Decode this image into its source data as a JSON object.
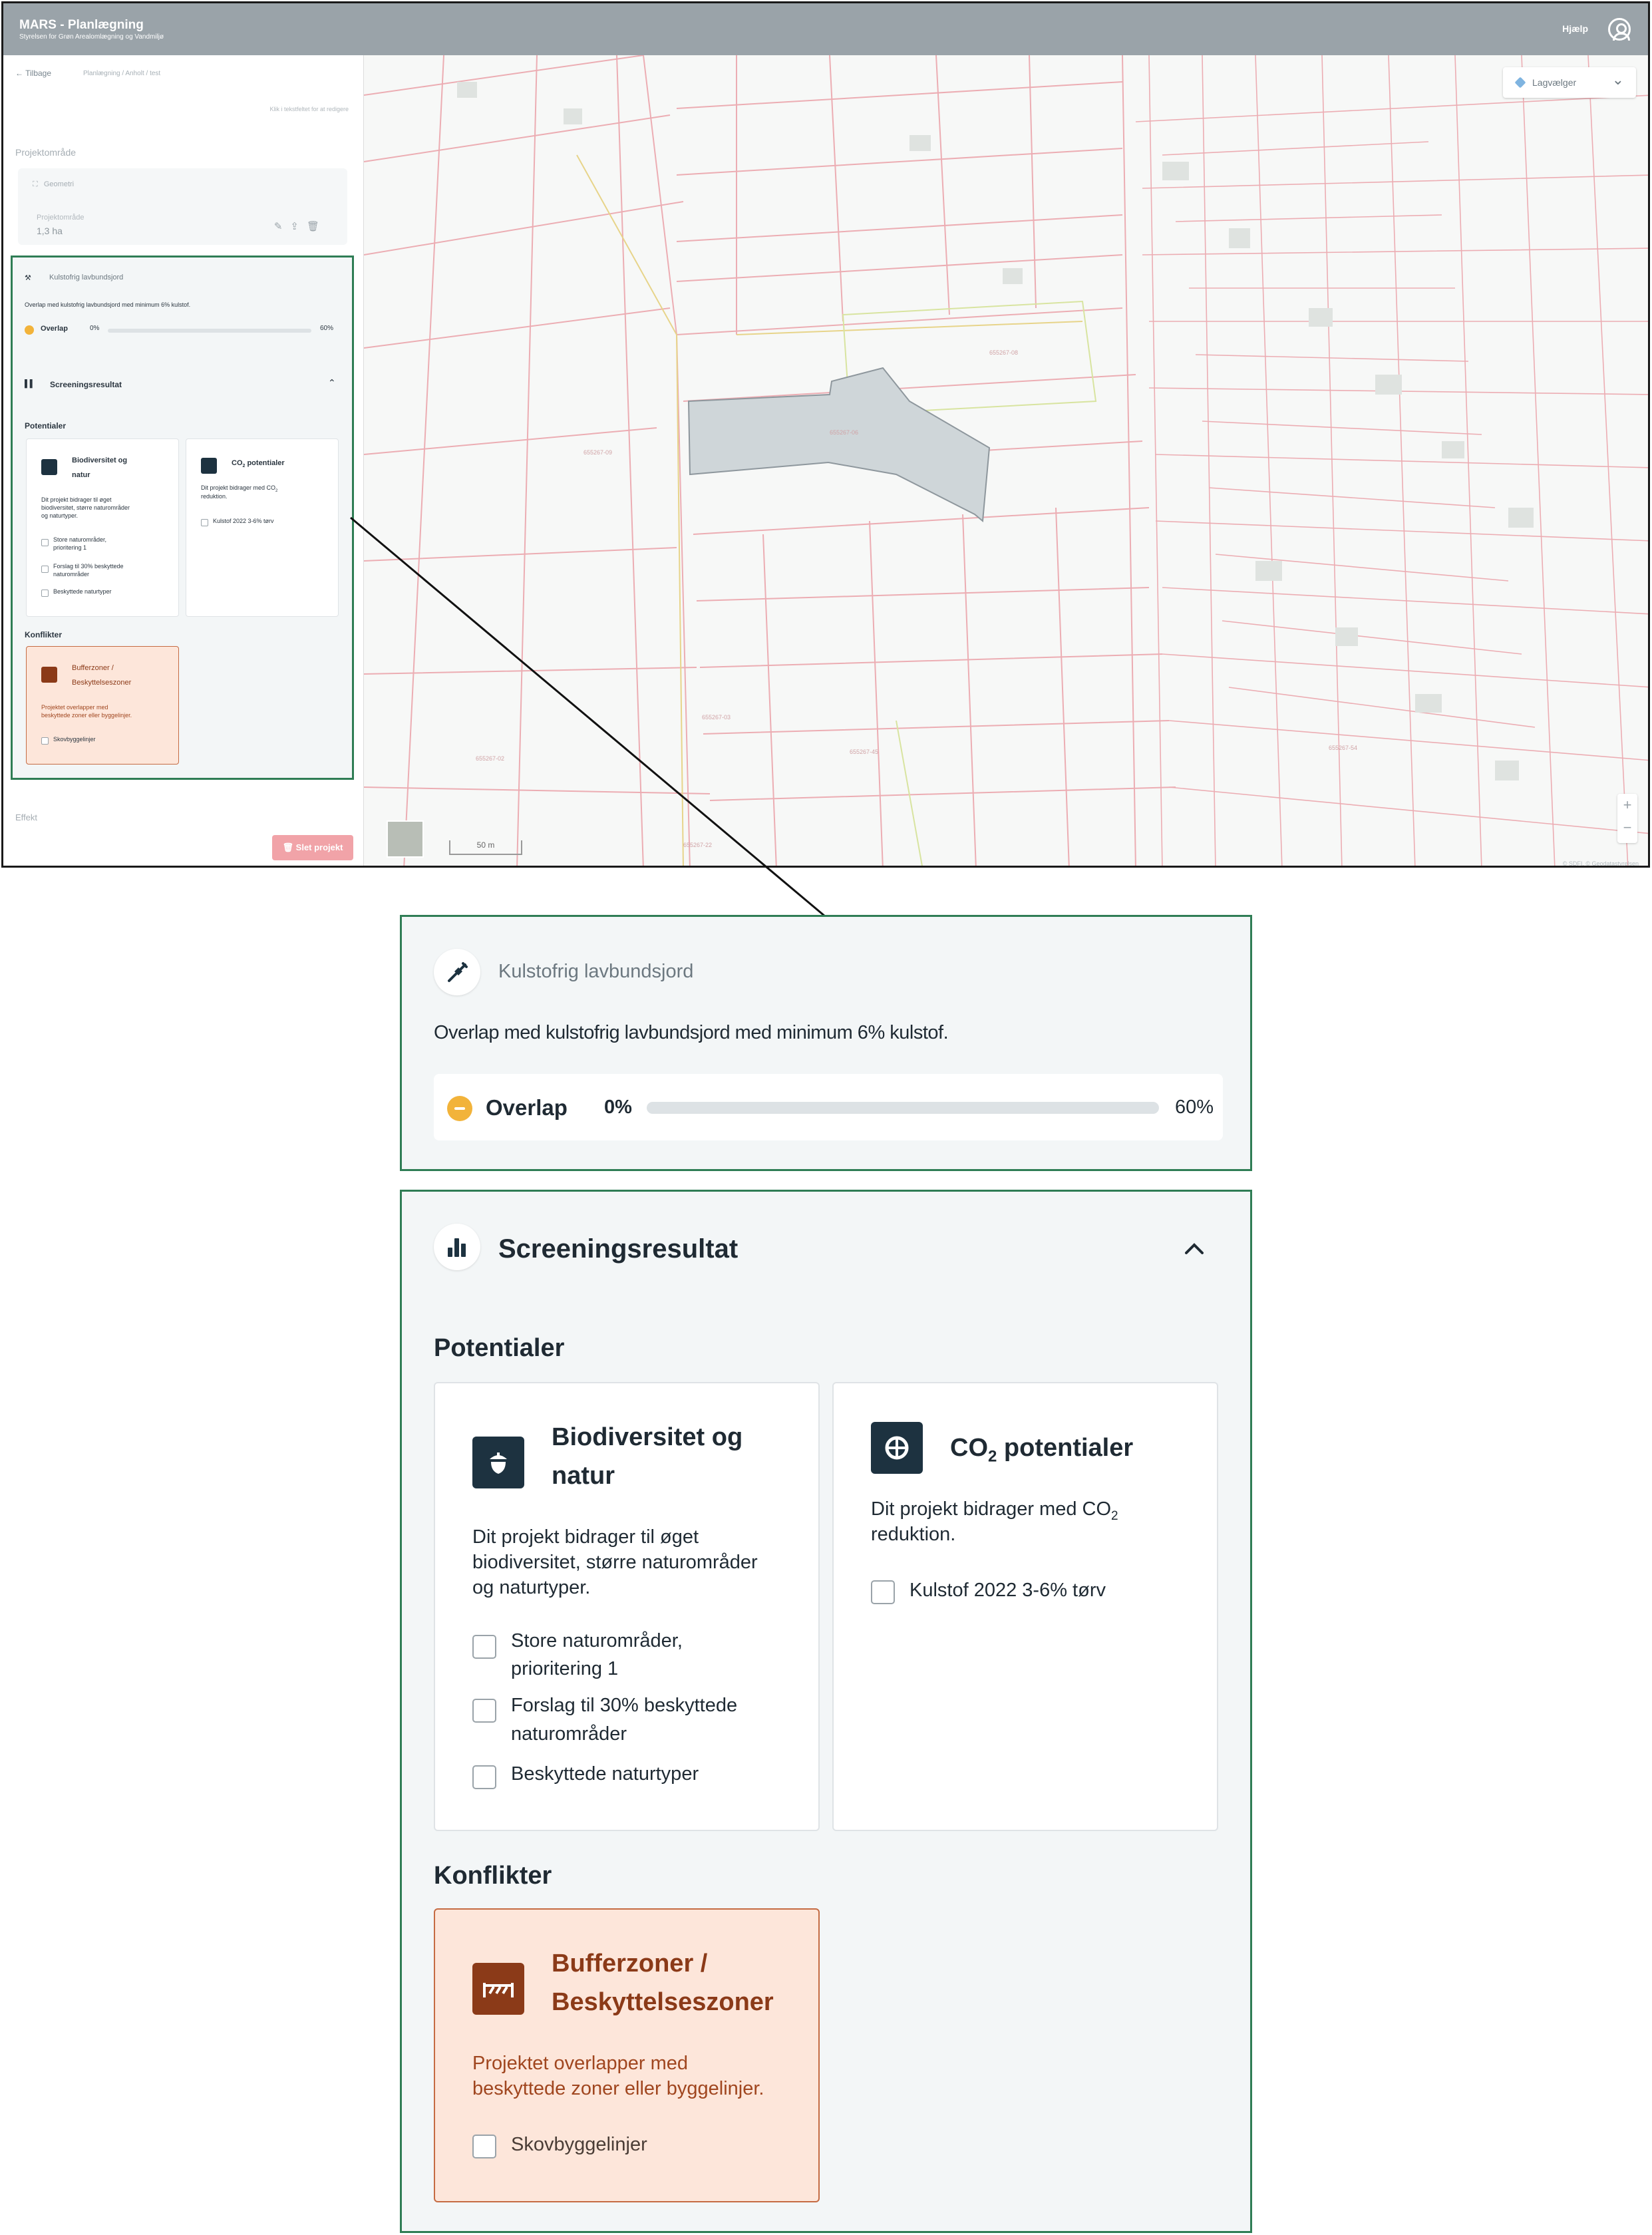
{
  "app": {
    "title": "MARS - Planlægning",
    "subtitle": "Styrelsen for Grøn Arealomlægning og Vandmiljø",
    "help_label": "Hjælp",
    "user_icon": "user-circle-icon"
  },
  "sidebar": {
    "back_label": "← Tilbage",
    "breadcrumb": "Planlægning / Anholt / test",
    "edit_hint": "Klik i tekstfeltet for at redigere",
    "project_area_heading": "Projektområde",
    "geometry_label": "Geometri",
    "area_label": "Projektområde",
    "area_value": "1,3 ha",
    "effect_heading": "Effekt",
    "delete_label": "Slet projekt"
  },
  "map": {
    "layer_selector": "Lagvælger",
    "zoom_in": "+",
    "zoom_out": "−",
    "scale_label": "50 m",
    "attribution": "© SDFI, © Geodatastyrelsen",
    "parcel_labels": [
      "655267-09",
      "655267-08",
      "655267-06",
      "655267-03",
      "655267-02",
      "655267-45",
      "655267-22",
      "655267-54"
    ]
  },
  "kulstof": {
    "title": "Kulstofrig lavbundsjord",
    "description": "Overlap med kulstofrig lavbundsjord med minimum 6% kulstof.",
    "overlap_label": "Overlap",
    "range_min": "0%",
    "range_max": "60%",
    "overlap_fraction": 0,
    "status_icon": "minus-circle-icon",
    "status_color": "#f2b33a"
  },
  "screening": {
    "title": "Screeningsresultat",
    "potentials_heading": "Potentialer",
    "conflicts_heading": "Konflikter",
    "biodiversity": {
      "title_line1": "Biodiversitet og",
      "title_line2": "natur",
      "desc_line1": "Dit projekt bidrager til øget",
      "desc_line2": "biodiversitet, større naturområder",
      "desc_line3": "og naturtyper.",
      "items": [
        {
          "line1": "Store naturområder,",
          "line2": "prioritering 1"
        },
        {
          "line1": "Forslag til 30% beskyttede",
          "line2": "naturområder"
        },
        {
          "line1": "Beskyttede naturtyper",
          "line2": ""
        }
      ]
    },
    "co2": {
      "title_pre": "CO",
      "title_sub": "2",
      "title_post": " potentialer",
      "desc_pre": "Dit projekt bidrager med CO",
      "desc_sub": "2",
      "desc_post": "reduktion.",
      "items": [
        {
          "line1": "Kulstof 2022 3-6% tørv"
        }
      ]
    },
    "buffer": {
      "title_line1": "Bufferzoner /",
      "title_line2": "Beskyttelseszoner",
      "desc_line1": "Projektet overlapper med",
      "desc_line2": "beskyttede zoner eller byggelinjer.",
      "items": [
        {
          "line1": "Skovbyggelinjer"
        }
      ]
    }
  },
  "colors": {
    "accent_green": "#2f7d55",
    "dark_navy": "#1d3240",
    "conflict_bg": "#fde6da",
    "conflict_text": "#8b3a18",
    "delete_btn": "#f1a3a8"
  }
}
